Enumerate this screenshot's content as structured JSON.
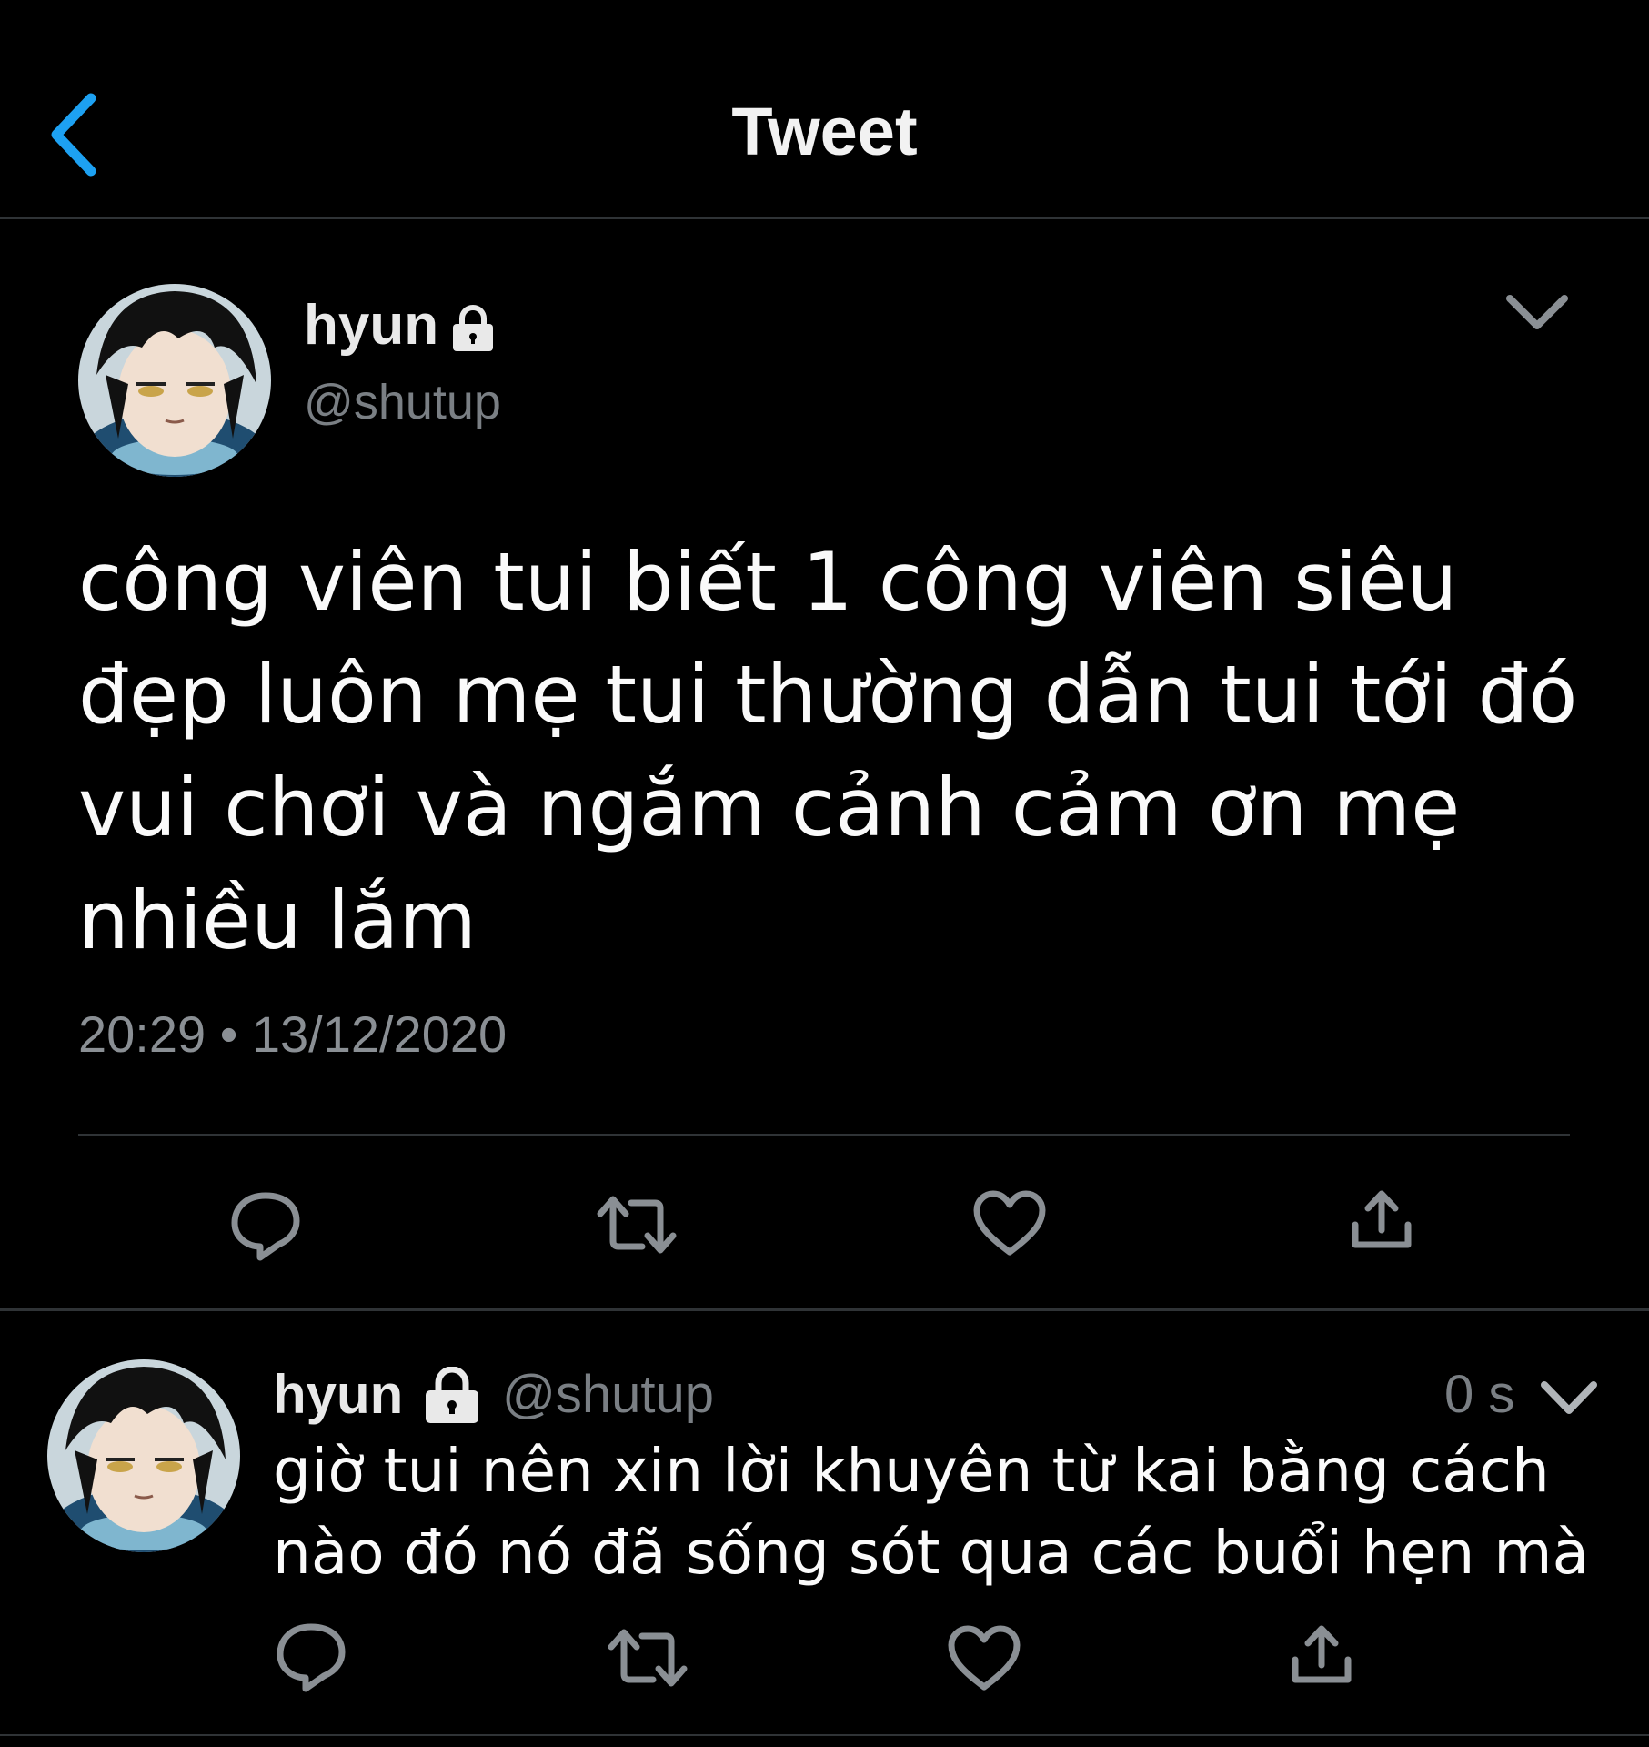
{
  "header": {
    "title": "Tweet",
    "back_icon": "chevron-left-icon",
    "accent": "#1da1f2"
  },
  "main_tweet": {
    "author_name": "hyun",
    "locked_icon": "lock-icon",
    "handle": "@shutup",
    "text": "công viên tui biết 1 công viên siêu đẹp luôn mẹ tui thường dẫn tui tới đó vui chơi và ngắm cảnh cảm ơn mẹ nhiều lắm",
    "timestamp": "20:29 • 13/12/2020",
    "actions": [
      "reply-icon",
      "retweet-icon",
      "like-icon",
      "share-icon"
    ]
  },
  "reply": {
    "author_name": "hyun",
    "handle": "@shutup",
    "time_ago": "0 s",
    "text": "giờ tui nên xin lời khuyên từ kai bằng cách nào đó nó đã sống sót qua các buổi hẹn mà",
    "actions": [
      "reply-icon",
      "retweet-icon",
      "like-icon",
      "share-icon"
    ]
  }
}
